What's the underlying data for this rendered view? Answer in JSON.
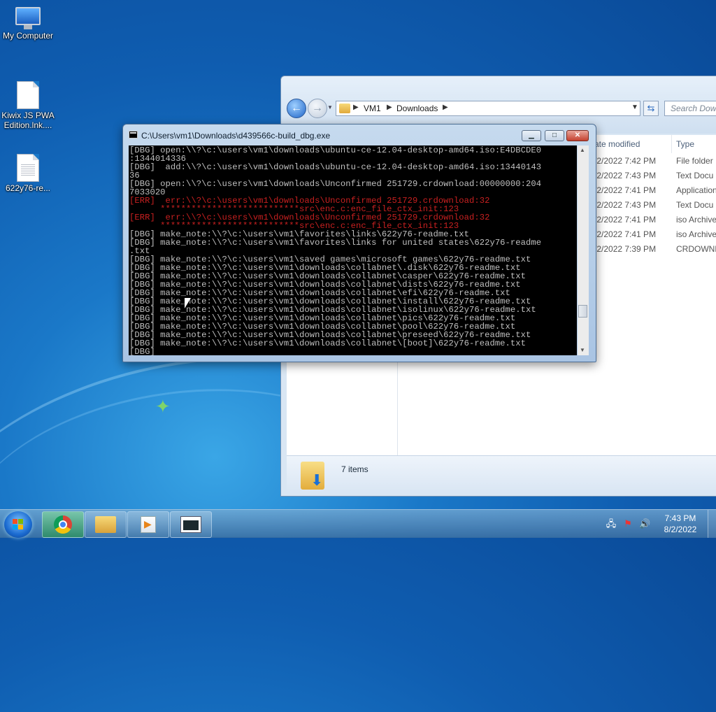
{
  "desktop": {
    "icons": [
      {
        "label": "My Computer"
      },
      {
        "label": "Kiwix JS PWA Edition.lnk...."
      },
      {
        "label": "622y76-re..."
      }
    ]
  },
  "explorer": {
    "breadcrumb": [
      "VM1",
      "Downloads"
    ],
    "search_placeholder": "Search Downl",
    "columns": {
      "date": "ate modified",
      "type": "Type"
    },
    "rows": [
      {
        "date": "/2/2022 7:42 PM",
        "type": "File folder"
      },
      {
        "date": "/2/2022 7:43 PM",
        "type": "Text Docu"
      },
      {
        "date": "/2/2022 7:41 PM",
        "type": "Application"
      },
      {
        "date": "/2/2022 7:43 PM",
        "type": "Text Docu"
      },
      {
        "date": "/2/2022 7:41 PM",
        "type": "iso Archive"
      },
      {
        "date": "/2/2022 7:41 PM",
        "type": "iso Archive"
      },
      {
        "date": "/2/2022 7:39 PM",
        "type": "CRDOWNL"
      }
    ],
    "status_count": "7 items"
  },
  "console": {
    "title": "C:\\Users\\vm1\\Downloads\\d439566c-build_dbg.exe",
    "lines": [
      {
        "text": "[DBG] open:\\\\?\\c:\\users\\vm1\\downloads\\ubuntu-ce-12.04-desktop-amd64.iso:E4DBCDE0",
        "err": false
      },
      {
        "text": ":1344014336",
        "err": false
      },
      {
        "text": "[DBG]  add:\\\\?\\c:\\users\\vm1\\downloads\\ubuntu-ce-12.04-desktop-amd64.iso:13440143",
        "err": false
      },
      {
        "text": "36",
        "err": false
      },
      {
        "text": "[DBG] open:\\\\?\\c:\\users\\vm1\\downloads\\Unconfirmed 251729.crdownload:00000000:204",
        "err": false
      },
      {
        "text": "7033020",
        "err": false
      },
      {
        "text": "[ERR]  err:\\\\?\\c:\\users\\vm1\\downloads\\Unconfirmed 251729.crdownload:32",
        "err": true
      },
      {
        "text": "      ***************************src\\enc.c:enc_file_ctx_init:123",
        "err": true
      },
      {
        "text": "[ERR]  err:\\\\?\\c:\\users\\vm1\\downloads\\Unconfirmed 251729.crdownload:32",
        "err": true
      },
      {
        "text": "      ***************************src\\enc.c:enc_file_ctx_init:123",
        "err": true
      },
      {
        "text": "[DBG] make_note:\\\\?\\c:\\users\\vm1\\favorites\\links\\622y76-readme.txt",
        "err": false
      },
      {
        "text": "[DBG] make_note:\\\\?\\c:\\users\\vm1\\favorites\\links for united states\\622y76-readme",
        "err": false
      },
      {
        "text": ".txt",
        "err": false
      },
      {
        "text": "[DBG] make_note:\\\\?\\c:\\users\\vm1\\saved games\\microsoft games\\622y76-readme.txt",
        "err": false
      },
      {
        "text": "[DBG] make_note:\\\\?\\c:\\users\\vm1\\downloads\\collabnet\\.disk\\622y76-readme.txt",
        "err": false
      },
      {
        "text": "[DBG] make_note:\\\\?\\c:\\users\\vm1\\downloads\\collabnet\\casper\\622y76-readme.txt",
        "err": false
      },
      {
        "text": "[DBG] make_note:\\\\?\\c:\\users\\vm1\\downloads\\collabnet\\dists\\622y76-readme.txt",
        "err": false
      },
      {
        "text": "[DBG] make_note:\\\\?\\c:\\users\\vm1\\downloads\\collabnet\\efi\\622y76-readme.txt",
        "err": false
      },
      {
        "text": "[DBG] make_note:\\\\?\\c:\\users\\vm1\\downloads\\collabnet\\install\\622y76-readme.txt",
        "err": false
      },
      {
        "text": "[DBG] make_note:\\\\?\\c:\\users\\vm1\\downloads\\collabnet\\isolinux\\622y76-readme.txt",
        "err": false
      },
      {
        "text": "[DBG] make_note:\\\\?\\c:\\users\\vm1\\downloads\\collabnet\\pics\\622y76-readme.txt",
        "err": false
      },
      {
        "text": "[DBG] make_note:\\\\?\\c:\\users\\vm1\\downloads\\collabnet\\pool\\622y76-readme.txt",
        "err": false
      },
      {
        "text": "[DBG] make_note:\\\\?\\c:\\users\\vm1\\downloads\\collabnet\\preseed\\622y76-readme.txt",
        "err": false
      },
      {
        "text": "[DBG] make_note:\\\\?\\c:\\users\\vm1\\downloads\\collabnet\\[boot]\\622y76-readme.txt",
        "err": false
      },
      {
        "text": "[DBG]",
        "err": false
      }
    ]
  },
  "taskbar": {
    "clock_time": "7:43 PM",
    "clock_date": "8/2/2022"
  },
  "colors": {
    "console_error": "#c82020",
    "console_text": "#c0c0c0",
    "accent": "#1a78c8"
  }
}
